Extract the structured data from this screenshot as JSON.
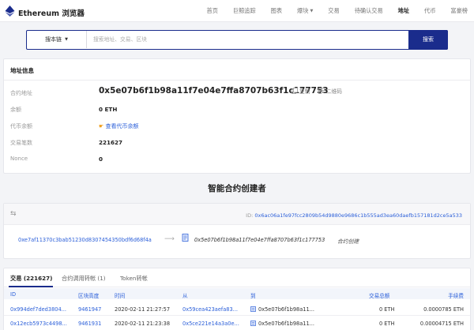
{
  "header": {
    "brand": "Ethereum 浏览器",
    "nav": [
      {
        "label": "首页",
        "active": false,
        "dropdown": false
      },
      {
        "label": "巨鲸追踪",
        "active": false,
        "dropdown": false
      },
      {
        "label": "图表",
        "active": false,
        "dropdown": false
      },
      {
        "label": "爆块",
        "active": false,
        "dropdown": true
      },
      {
        "label": "交易",
        "active": false,
        "dropdown": false
      },
      {
        "label": "待确认交易",
        "active": false,
        "dropdown": false
      },
      {
        "label": "地址",
        "active": true,
        "dropdown": false
      },
      {
        "label": "代币",
        "active": false,
        "dropdown": false
      },
      {
        "label": "富豪榜",
        "active": false,
        "dropdown": false
      }
    ]
  },
  "search": {
    "chain_label": "搜本链",
    "placeholder": "搜索地址、交易、区块",
    "button_label": "搜索"
  },
  "address_info": {
    "title": "地址信息",
    "labels": {
      "address": "合约地址",
      "balance": "余额",
      "token_balance": "代币余额",
      "tx_count": "交易笔数",
      "nonce": "Nonce"
    },
    "address": "0x5e07b6f1b98a11f7e04e7ffa8707b63f1c177753",
    "copy_label": "复制",
    "qrcode_label": "二维码",
    "balance": "0 ETH",
    "token_balance_link": "查看代币余额",
    "tx_count": "221627",
    "nonce": "0"
  },
  "creator": {
    "title": "智能合约创建者",
    "tx_id_label": "ID:",
    "tx_id": "0x6ac06a1fe97fcc2809b54d9880e9686c1b555ad3ea60daefb157181d2ce5a533",
    "from": "0xe7af11370c3bab51230d8307454350bdf6d68f4a",
    "to": "0x5e07b6f1b98a11f7e04e7ffa8707b63f1c177753",
    "action": "合约创建"
  },
  "transactions": {
    "tabs": [
      {
        "label": "交易 (221627)",
        "active": true
      },
      {
        "label": "合约调用转帐 (1)",
        "active": false
      },
      {
        "label": "Token转帐",
        "active": false
      }
    ],
    "columns": {
      "id": "ID",
      "block": "区块高度",
      "time": "时间",
      "from": "从",
      "to": "到",
      "amount": "交易总额",
      "fee": "手续费"
    },
    "rows": [
      {
        "id": "0x994def7ded3804...",
        "block": "9461947",
        "time": "2020-02-11 21:27:57",
        "from": "0x59cea423aefa83...",
        "to": "0x5e07b6f1b98a11...",
        "amount": "0 ETH",
        "fee": "0.0000785 ETH"
      },
      {
        "id": "0x12ecb5973c4498...",
        "block": "9461931",
        "time": "2020-02-11 21:23:38",
        "from": "0x5ce221e14a3a0e...",
        "to": "0x5e07b6f1b98a11...",
        "amount": "0 ETH",
        "fee": "0.00004715 ETH"
      }
    ]
  },
  "colors": {
    "primary": "#1a2c8c",
    "link": "#2b5fd9"
  }
}
